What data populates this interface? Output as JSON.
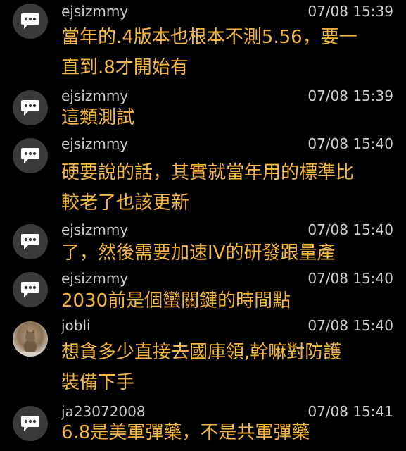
{
  "messages": [
    {
      "user": "ejsizmmy",
      "time": "07/08 15:39",
      "text": "當年的.4版本也根本不測5.56，要一\n直到.8才開始有",
      "avatar": "chat-bubble-icon"
    },
    {
      "user": "ejsizmmy",
      "time": "07/08 15:39",
      "text": "這類測試",
      "avatar": "chat-bubble-icon"
    },
    {
      "user": "ejsizmmy",
      "time": "07/08 15:40",
      "text": "硬要說的話，其實就當年用的標準比\n較老了也該更新",
      "avatar": "chat-bubble-icon"
    },
    {
      "user": "ejsizmmy",
      "time": "07/08 15:40",
      "text": "了，然後需要加速IV的研發跟量產",
      "avatar": "chat-bubble-icon"
    },
    {
      "user": "ejsizmmy",
      "time": "07/08 15:40",
      "text": "2030前是個蠻關鍵的時間點",
      "avatar": "chat-bubble-icon"
    },
    {
      "user": "jobli",
      "time": "07/08 15:40",
      "text": "想貪多少直接去國庫領,幹嘛對防護\n裝備下手",
      "avatar": "cat-photo-avatar"
    },
    {
      "user": "ja23072008",
      "time": "07/08 15:41",
      "text": "6.8是美軍彈藥，不是共軍彈藥",
      "avatar": "chat-bubble-icon"
    }
  ]
}
